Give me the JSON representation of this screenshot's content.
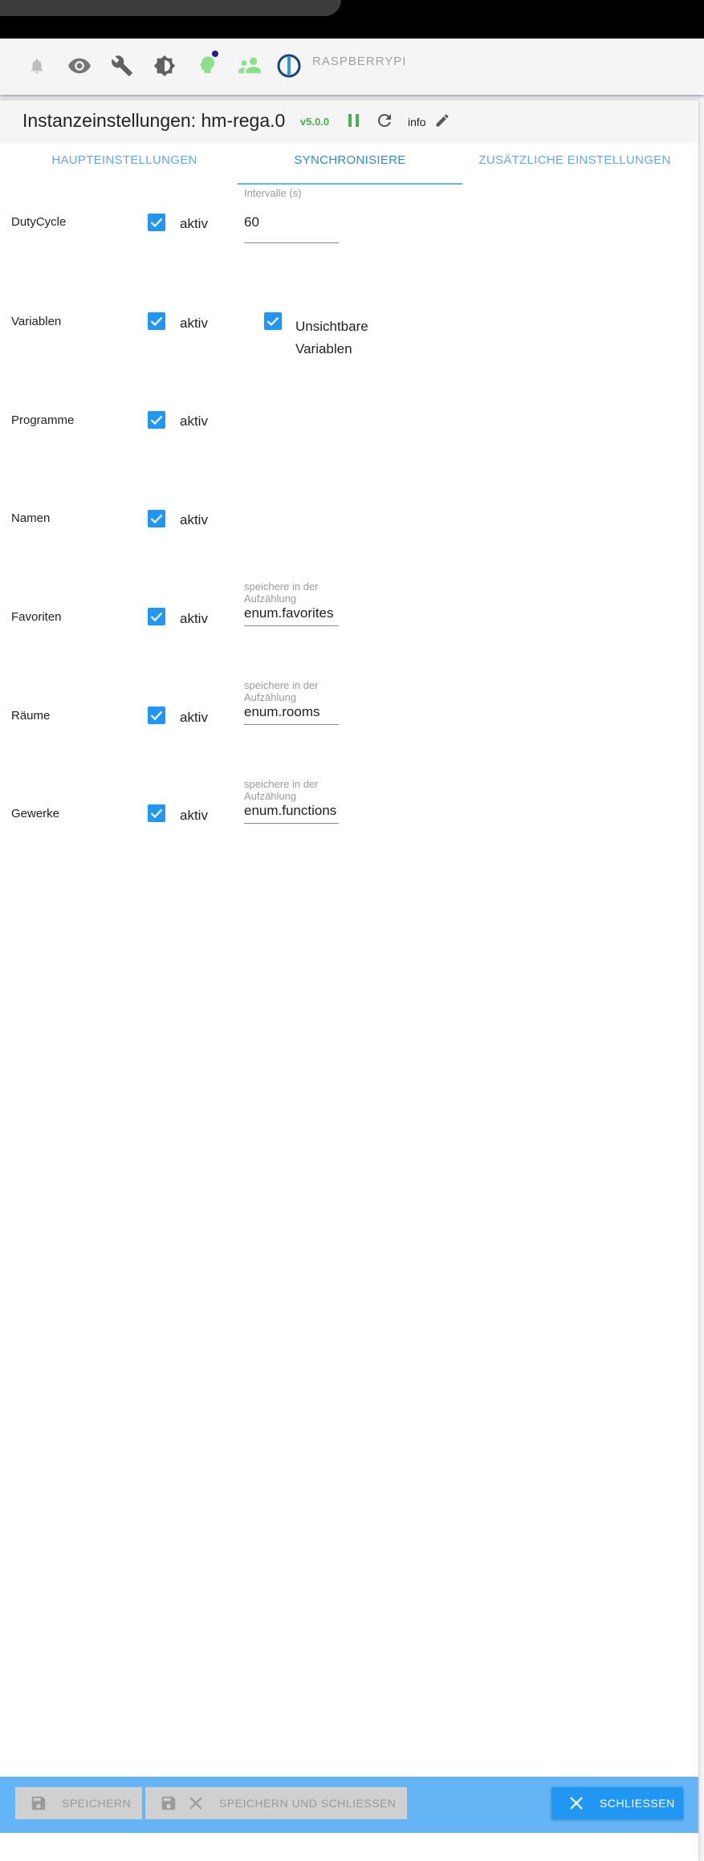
{
  "toolbar": {
    "icons": [
      "bell-icon",
      "eye-icon",
      "wrench-icon",
      "brightness-icon",
      "head-icon",
      "users-icon",
      "iobroker-logo-icon"
    ],
    "host_label": "RASPBERRYPI"
  },
  "dialog": {
    "title": "Instanzeinstellungen: hm-rega.0",
    "version": "v5.0.0",
    "info": "info"
  },
  "tabs": [
    {
      "label": "HAUPTEINSTELLUNGEN"
    },
    {
      "label": "SYNCHRONISIERE"
    },
    {
      "label": "ZUSÄTZLICHE EINSTELLUNGEN"
    }
  ],
  "rows": [
    {
      "label": "DutyCycle",
      "active_label": "aktiv",
      "field_label": "Intervalle (s)",
      "field_value": "60"
    },
    {
      "label": "Variablen",
      "active_label": "aktiv",
      "extra_label": "Unsichtbare Variablen"
    },
    {
      "label": "Programme",
      "active_label": "aktiv"
    },
    {
      "label": "Namen",
      "active_label": "aktiv"
    },
    {
      "label": "Favoriten",
      "active_label": "aktiv",
      "field_label": "speichere in der Aufzählung",
      "field_value": "enum.favorites"
    },
    {
      "label": "Räume",
      "active_label": "aktiv",
      "field_label": "speichere in der Aufzählung",
      "field_value": "enum.rooms"
    },
    {
      "label": "Gewerke",
      "active_label": "aktiv",
      "field_label": "speichere in der Aufzählung",
      "field_value": "enum.functions"
    }
  ],
  "buttons": {
    "save": "SPEICHERN",
    "save_close": "SPEICHERN UND SCHLIESSEN",
    "close": "SCHLIESSEN"
  },
  "colors": {
    "accent": "#2196f3",
    "bottom_bar": "#64b5f6",
    "version_green": "#4caf50"
  }
}
